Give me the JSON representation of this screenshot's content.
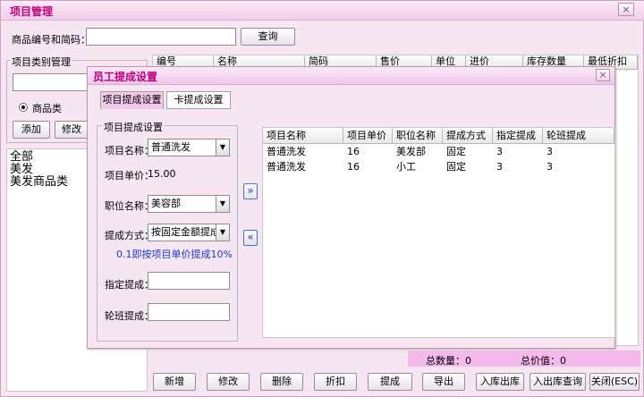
{
  "window": {
    "title": "项目管理",
    "close": "×"
  },
  "search": {
    "label": "商品编号和简码：",
    "value": "",
    "button": "查询"
  },
  "category": {
    "group_title": "项目类别管理",
    "input_value": "",
    "radio_label": "商品类",
    "add_button": "添加",
    "edit_button": "修改",
    "tree": [
      "全部",
      "美发",
      "美发商品类"
    ]
  },
  "main_table": {
    "headers": [
      "编号",
      "名称",
      "简码",
      "售价",
      "单位",
      "进价",
      "库存数量",
      "最低折扣"
    ]
  },
  "dialog": {
    "title": "员工提成设置",
    "close": "×",
    "tabs": [
      "项目提成设置",
      "卡提成设置"
    ],
    "group_title": "项目提成设置",
    "item_name_label": "项目名称：",
    "item_name_value": "普通洗发",
    "unit_price_label": "项目单价：",
    "unit_price_value": "15.00",
    "position_label": "职位名称：",
    "position_value": "美容部",
    "method_label": "提成方式：",
    "method_value": "按固定金额提成",
    "hint": "0.1即按项目单价提成10%",
    "designated_label": "指定提成：",
    "designated_value": "",
    "rotation_label": "轮班提成：",
    "rotation_value": "",
    "move_right": "»",
    "move_left": "«",
    "table": {
      "headers": [
        "项目名称",
        "项目单价",
        "职位名称",
        "提成方式",
        "指定提成",
        "轮班提成"
      ],
      "rows": [
        [
          "普通洗发",
          "16",
          "美发部",
          "固定",
          "3",
          "3"
        ],
        [
          "普通洗发",
          "16",
          "小工",
          "固定",
          "3",
          "3"
        ]
      ]
    }
  },
  "status": {
    "total_qty_label": "总数量：0",
    "total_value_label": "总价值：0"
  },
  "toolbar": [
    "新增",
    "修改",
    "删除",
    "折扣",
    "提成",
    "导出",
    "入库出库",
    "入出库查询",
    "关闭(ESC)"
  ]
}
